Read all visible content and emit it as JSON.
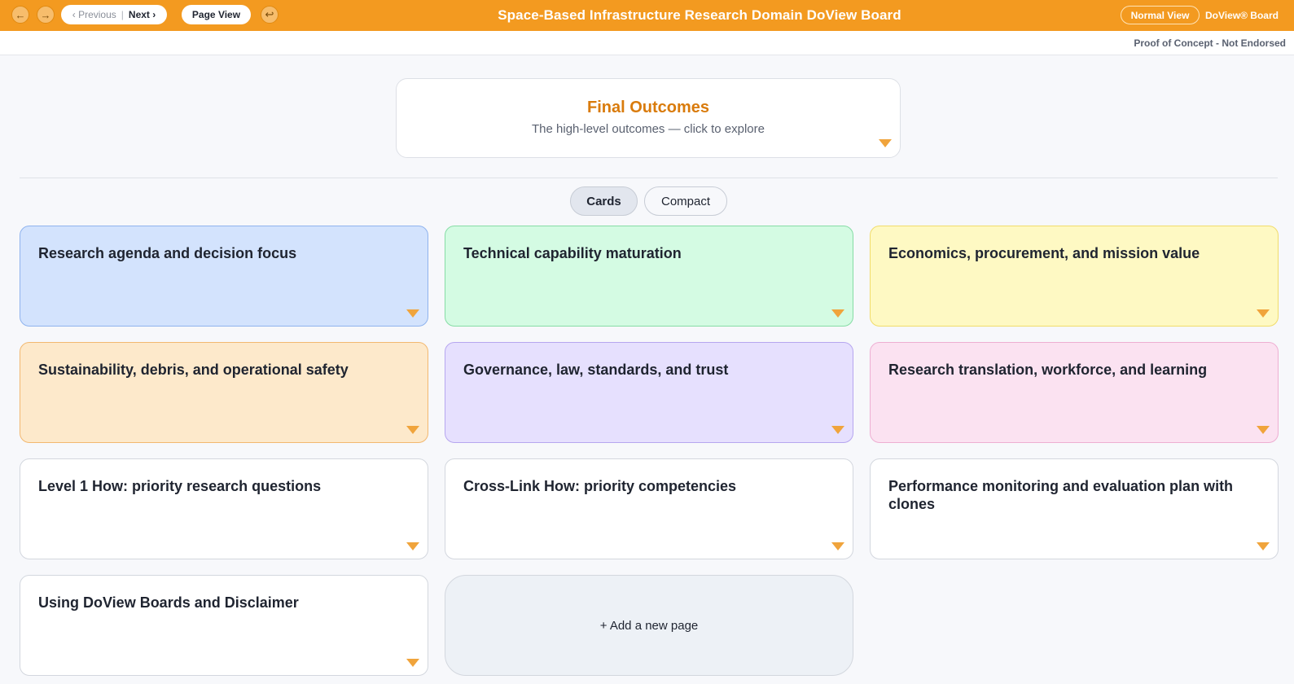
{
  "topbar": {
    "back_icon": "arrow-left-icon",
    "forward_icon": "arrow-right-icon",
    "previous_label": "‹ Previous",
    "separator": "|",
    "next_label": "Next ›",
    "page_view_label": "Page View",
    "undo_icon": "return-arrow-icon",
    "title": "Space-Based Infrastructure Research Domain DoView Board",
    "normal_view_label": "Normal View",
    "brand": "DoView® Board",
    "color": "#f39a20"
  },
  "subbar": {
    "notice": "Proof of Concept - Not Endorsed"
  },
  "hero": {
    "title": "Final Outcomes",
    "subtitle": "The high-level outcomes — click to explore",
    "expand_icon": "caret-down-icon"
  },
  "view_toggle": {
    "cards_label": "Cards",
    "compact_label": "Compact",
    "selected": "Cards"
  },
  "cards": [
    {
      "label": "Research agenda and decision focus",
      "color": "#d3e3fd",
      "border": "#8fb3ee"
    },
    {
      "label": "Technical capability maturation",
      "color": "#d4fbe3",
      "border": "#86dca5"
    },
    {
      "label": "Economics, procurement, and mission value",
      "color": "#fef9c3",
      "border": "#f1dc6a"
    },
    {
      "label": "Sustainability, debris, and operational safety",
      "color": "#fde9cb",
      "border": "#f2b870"
    },
    {
      "label": "Governance, law, standards, and trust",
      "color": "#e6e0fe",
      "border": "#b6a6ef"
    },
    {
      "label": "Research translation, workforce, and learning",
      "color": "#fbe2f1",
      "border": "#eeaed2"
    },
    {
      "label": "Level 1 How: priority research questions",
      "color": "#ffffff",
      "border": "#d3d7de"
    },
    {
      "label": "Cross-Link How: priority competencies",
      "color": "#ffffff",
      "border": "#d3d7de"
    },
    {
      "label": "Performance monitoring and evaluation plan with clones",
      "color": "#ffffff",
      "border": "#d3d7de"
    },
    {
      "label": "Using DoView Boards and Disclaimer",
      "color": "#ffffff",
      "border": "#d3d7de"
    }
  ],
  "add_page_label": "+ Add a new page"
}
